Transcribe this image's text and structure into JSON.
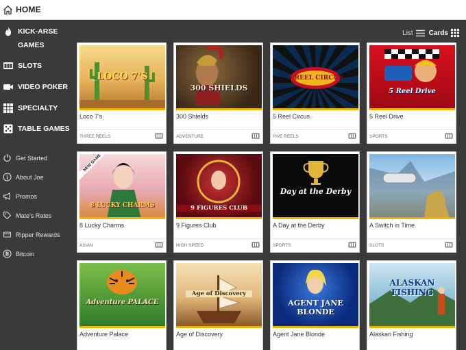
{
  "header": {
    "home_label": "HOME"
  },
  "sidebar": {
    "categories": [
      {
        "label": "KICK-ARSE GAMES",
        "icon": "flame-icon"
      },
      {
        "label": "SLOTS",
        "icon": "slot-machine-icon"
      },
      {
        "label": "VIDEO POKER",
        "icon": "video-camera-icon"
      },
      {
        "label": "SPECIALTY",
        "icon": "grid-icon"
      },
      {
        "label": "TABLE GAMES",
        "icon": "dice-icon"
      }
    ],
    "links": [
      {
        "label": "Get Started",
        "icon": "power-icon"
      },
      {
        "label": "About Joe",
        "icon": "info-icon"
      },
      {
        "label": "Promos",
        "icon": "megaphone-icon"
      },
      {
        "label": "Mate's Rates",
        "icon": "tag-icon"
      },
      {
        "label": "Ripper Rewards",
        "icon": "reward-icon"
      },
      {
        "label": "Bitcoin",
        "icon": "bitcoin-icon"
      }
    ]
  },
  "view_toggle": {
    "list_label": "List",
    "cards_label": "Cards"
  },
  "games": [
    {
      "title": "Loco 7's",
      "category": "THREE REELS",
      "art": "LOCO 7'S"
    },
    {
      "title": "300 Shields",
      "category": "ADVENTURE",
      "art": "300 SHIELDS"
    },
    {
      "title": "5 Reel Circus",
      "category": "FIVE REELS",
      "art": "5 REEL CIRCUS"
    },
    {
      "title": "5 Reel Drive",
      "category": "SPORTS",
      "art": "5 Reel Drive"
    },
    {
      "title": "8 Lucky Charms",
      "category": "ASIAN",
      "art": "8 LUCKY CHARMS",
      "badge": "NEW GAME"
    },
    {
      "title": "9 Figures Club",
      "category": "HIGH SPEED",
      "art": "9 FIGURES CLUB"
    },
    {
      "title": "A Day at the Derby",
      "category": "SPORTS",
      "art": "Day at the Derby"
    },
    {
      "title": "A Switch in Time",
      "category": "SLOTS",
      "art": ""
    },
    {
      "title": "Adventure Palace",
      "category": "",
      "art": "Adventure PALACE"
    },
    {
      "title": "Age of Discovery",
      "category": "",
      "art": "Age of Discovery"
    },
    {
      "title": "Agent Jane Blonde",
      "category": "",
      "art": "AGENT JANE BLONDE"
    },
    {
      "title": "Alaskan Fishing",
      "category": "",
      "art": "ALASKAN FISHING"
    }
  ],
  "colors": {
    "accent": "#f0b400",
    "sidebar_bg": "#3a3a3a",
    "card_bg": "#ffffff"
  }
}
